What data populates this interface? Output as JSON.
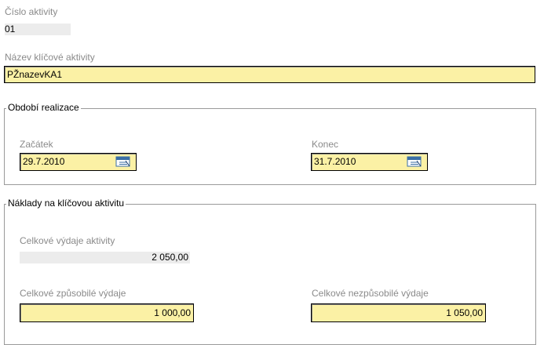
{
  "activity_number": {
    "label": "Číslo aktivity",
    "value": "01"
  },
  "key_activity_name": {
    "label": "Název klíčové aktivity",
    "value": "PŽnazevKA1"
  },
  "realization_period": {
    "legend": "Období realizace",
    "start": {
      "label": "Začátek",
      "value": "29.7.2010",
      "icon": "calendar-icon"
    },
    "end": {
      "label": "Konec",
      "value": "31.7.2010",
      "icon": "calendar-icon"
    }
  },
  "costs": {
    "legend": "Náklady na klíčovou aktivitu",
    "total": {
      "label": "Celkové výdaje aktivity",
      "value": "2 050,00"
    },
    "eligible": {
      "label": "Celkové způsobilé výdaje",
      "value": "1 000,00"
    },
    "ineligible": {
      "label": "Celkové nezpůsobilé výdaje",
      "value": "1 050,00"
    }
  },
  "colors": {
    "field_bg": "#fbf1a5",
    "readonly_bg": "#ececec",
    "label": "#8a8a8a"
  }
}
